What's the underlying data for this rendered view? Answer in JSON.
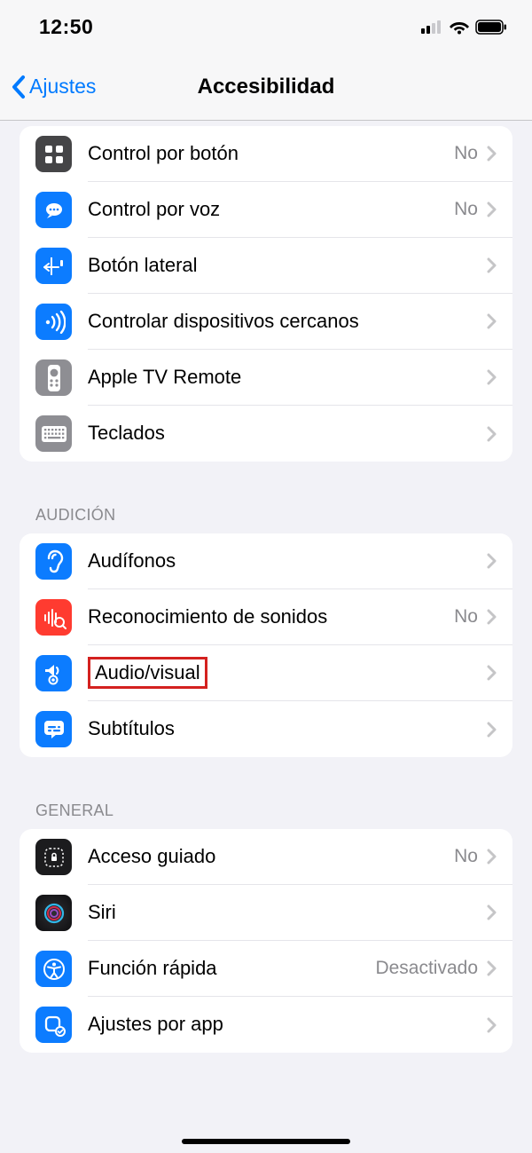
{
  "status": {
    "time": "12:50"
  },
  "nav": {
    "back": "Ajustes",
    "title": "Accesibilidad"
  },
  "groups": {
    "physical": {
      "switchControl": {
        "label": "Control por botón",
        "value": "No"
      },
      "voiceControl": {
        "label": "Control por voz",
        "value": "No"
      },
      "sideButton": {
        "label": "Botón lateral"
      },
      "nearbyDevices": {
        "label": "Controlar dispositivos cercanos"
      },
      "tvRemote": {
        "label": "Apple TV Remote"
      },
      "keyboards": {
        "label": "Teclados"
      }
    },
    "hearing": {
      "header": "AUDICIÓN",
      "headphones": {
        "label": "Audífonos"
      },
      "soundRecognition": {
        "label": "Reconocimiento de sonidos",
        "value": "No"
      },
      "audioVisual": {
        "label": "Audio/visual"
      },
      "subtitles": {
        "label": "Subtítulos"
      }
    },
    "general": {
      "header": "GENERAL",
      "guidedAccess": {
        "label": "Acceso guiado",
        "value": "No"
      },
      "siri": {
        "label": "Siri"
      },
      "shortcut": {
        "label": "Función rápida",
        "value": "Desactivado"
      },
      "perApp": {
        "label": "Ajustes por app"
      }
    }
  }
}
